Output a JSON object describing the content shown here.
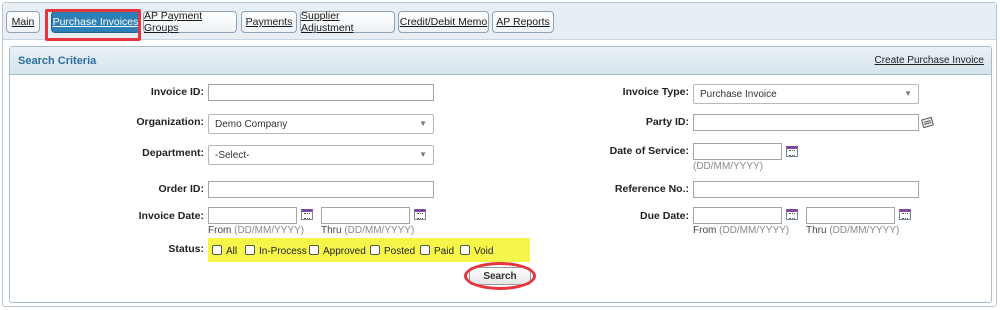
{
  "tabs": [
    {
      "label": "Main"
    },
    {
      "label": "Purchase Invoices"
    },
    {
      "label": "AP Payment Groups"
    },
    {
      "label": "Payments"
    },
    {
      "label": "Supplier Adjustment"
    },
    {
      "label": "Credit/Debit Memo"
    },
    {
      "label": "AP Reports"
    }
  ],
  "active_tab": "Purchase Invoices",
  "panel": {
    "title": "Search Criteria",
    "create_link": "Create Purchase Invoice"
  },
  "left": {
    "invoice_id": {
      "label": "Invoice ID:",
      "value": ""
    },
    "organization": {
      "label": "Organization:",
      "value": "Demo Company"
    },
    "department": {
      "label": "Department:",
      "value": "-Select-"
    },
    "order_id": {
      "label": "Order ID:",
      "value": ""
    },
    "invoice_date": {
      "label": "Invoice Date:",
      "from_label": "From",
      "thru_label": "Thru",
      "format_hint": "(DD/MM/YYYY)",
      "from_value": "",
      "thru_value": ""
    }
  },
  "right": {
    "invoice_type": {
      "label": "Invoice Type:",
      "value": "Purchase Invoice"
    },
    "party_id": {
      "label": "Party ID:",
      "value": ""
    },
    "date_of_service": {
      "label": "Date of Service:",
      "format_hint": "(DD/MM/YYYY)",
      "value": ""
    },
    "reference_no": {
      "label": "Reference No.:",
      "value": ""
    },
    "due_date": {
      "label": "Due Date:",
      "from_label": "From",
      "thru_label": "Thru",
      "format_hint": "(DD/MM/YYYY)",
      "from_value": "",
      "thru_value": ""
    }
  },
  "status": {
    "label": "Status:",
    "options": [
      {
        "label": "All",
        "checked": false
      },
      {
        "label": "In-Process",
        "checked": false
      },
      {
        "label": "Approved",
        "checked": false
      },
      {
        "label": "Posted",
        "checked": false
      },
      {
        "label": "Paid",
        "checked": false
      },
      {
        "label": "Void",
        "checked": false
      }
    ]
  },
  "search_button": "Search",
  "colors": {
    "active_tab": "#2e7fb6",
    "highlight_annotation": "#e6353c",
    "status_highlight": "#f5f54a",
    "panel_title": "#2a6f9e"
  },
  "icons": [
    "calendar-icon",
    "party-lookup-icon",
    "chevron-down-icon"
  ]
}
